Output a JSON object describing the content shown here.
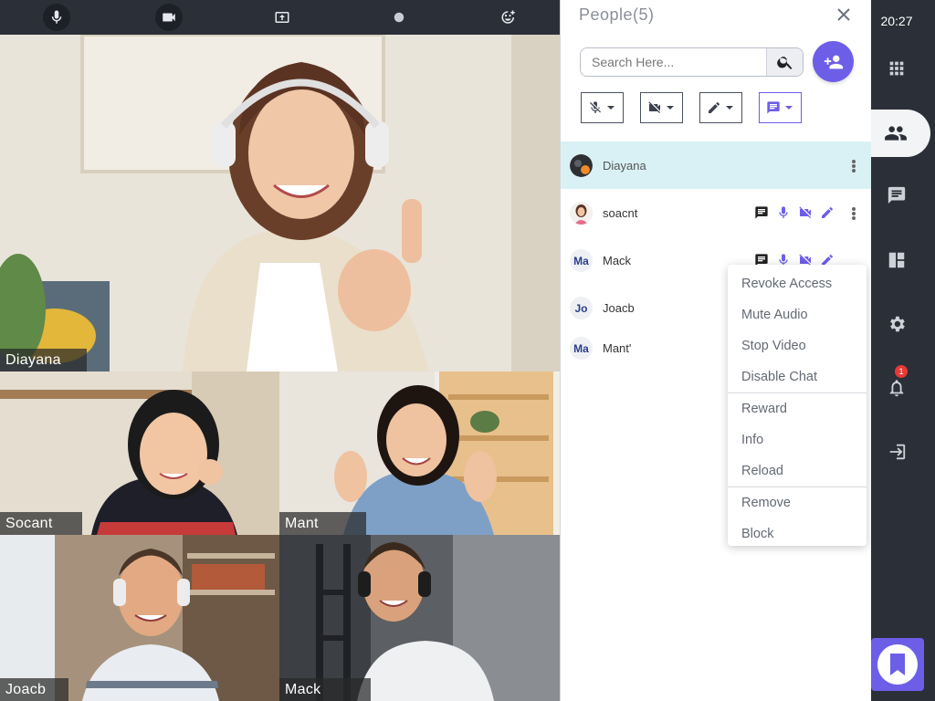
{
  "toolbar": {
    "icons": [
      "microphone-icon",
      "video-camera-icon",
      "share-screen-icon",
      "record-icon",
      "emoji-icon"
    ]
  },
  "videos": [
    {
      "name": "Diayana"
    },
    {
      "name": "Socant"
    },
    {
      "name": "Mant"
    },
    {
      "name": "Joacb"
    },
    {
      "name": "Mack"
    }
  ],
  "people_panel": {
    "title": "People(5)",
    "search_placeholder": "Search Here...",
    "filters": [
      "mic-off-icon",
      "video-off-icon",
      "pencil-icon",
      "chat-icon"
    ],
    "participants": [
      {
        "name": "Diayana",
        "avatar": "photo",
        "selected": true
      },
      {
        "name": "soacnt",
        "avatar": "photo",
        "selected": false
      },
      {
        "name": "Mack",
        "avatar": "Ma",
        "selected": false
      },
      {
        "name": "Joacb",
        "avatar": "Jo",
        "selected": false
      },
      {
        "name": "Mant'",
        "avatar": "Ma",
        "selected": false
      }
    ]
  },
  "context_menu": {
    "items": [
      "Revoke Access",
      "Mute Audio",
      "Stop Video",
      "Disable Chat",
      "Reward",
      "Info",
      "Reload",
      "Remove",
      "Block"
    ]
  },
  "rail": {
    "time": "20:27",
    "notification_count": "1",
    "icons": [
      "apps-grid-icon",
      "people-icon",
      "chat-icon",
      "layout-icon",
      "settings-icon",
      "bell-icon",
      "exit-icon",
      "bookmark-logo-icon"
    ]
  },
  "colors": {
    "accent": "#6d5ee8",
    "dark": "#2b2f38",
    "selected_row": "#d9f1f5",
    "badge": "#e53935"
  }
}
